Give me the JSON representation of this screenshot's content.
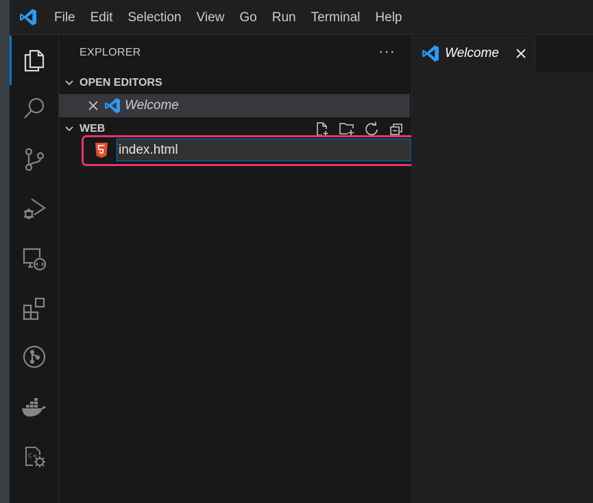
{
  "menu": {
    "items": [
      "File",
      "Edit",
      "Selection",
      "View",
      "Go",
      "Run",
      "Terminal",
      "Help"
    ]
  },
  "activitybar": {
    "items": [
      "explorer-icon",
      "search-icon",
      "source-control-icon",
      "run-debug-icon",
      "remote-explorer-icon",
      "extensions-icon",
      "git-graph-icon",
      "docker-icon",
      "cpp-settings-icon"
    ],
    "active": "explorer-icon"
  },
  "sidebar": {
    "title": "EXPLORER",
    "more": "···",
    "open_editors": {
      "title": "OPEN EDITORS",
      "items": [
        {
          "label": "Welcome"
        }
      ]
    },
    "workspace": {
      "title": "WEB",
      "new_file_value": "index.html"
    }
  },
  "editor": {
    "tab_label": "Welcome"
  },
  "colors": {
    "accent": "#0078d4",
    "highlight": "#e8336b",
    "html5": "#e44d26",
    "vscode_blue": "#2b9bf4"
  }
}
